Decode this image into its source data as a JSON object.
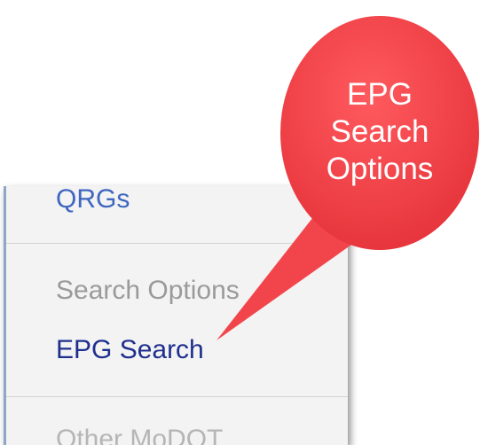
{
  "menu": {
    "items": [
      {
        "label": "QRGs"
      },
      {
        "label": "Search Options"
      },
      {
        "label": "EPG Search"
      },
      {
        "label": "Other MoDOT"
      }
    ]
  },
  "callout": {
    "lines": [
      "EPG",
      "Search",
      "Options"
    ],
    "fill_color": "#f2454b",
    "text_color": "#ffffff"
  },
  "colors": {
    "panel_bg": "#f3f3f3",
    "link": "#1f2f8e",
    "header_text": "#9a9a9a"
  }
}
